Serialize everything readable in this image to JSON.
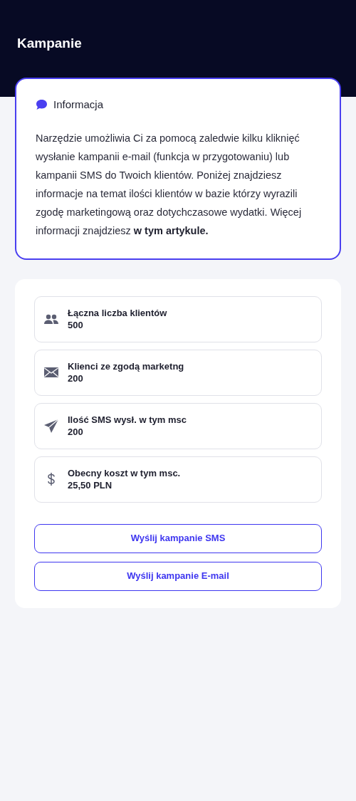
{
  "header": {
    "title": "Kampanie"
  },
  "info": {
    "title": "Informacja",
    "text": "Narzędzie umożliwia Ci za pomocą zaledwie kilku kliknięć wysłanie kampanii e-mail (funkcja w przygotowaniu) lub kampanii SMS do Twoich klientów. Poniżej znajdziesz informacje na temat ilości klientów w bazie którzy wyrazili zgodę marketingową oraz dotychczasowe wydatki. Więcej informacji znajdziesz",
    "link": "w tym artykule."
  },
  "stats": [
    {
      "kind": "users",
      "label": "Łączna liczba klientów",
      "value": "500"
    },
    {
      "kind": "mail",
      "label": "Klienci ze zgodą marketng",
      "value": "200"
    },
    {
      "kind": "send",
      "label": "Ilość SMS wysł. w tym msc",
      "value": "200"
    },
    {
      "kind": "dollar",
      "label": "Obecny koszt w tym msc.",
      "value": "25,50 PLN"
    }
  ],
  "buttons": [
    "Wyślij kampanie SMS",
    "Wyślij kampanie E-mail"
  ]
}
